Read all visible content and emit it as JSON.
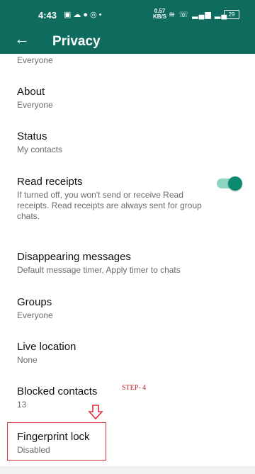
{
  "status_bar": {
    "time": "4:43",
    "speed": "0.57",
    "speed_unit": "KB/S",
    "battery": "29"
  },
  "header": {
    "title": "Privacy"
  },
  "partial_top": {
    "subtitle": "Everyone"
  },
  "settings": [
    {
      "title": "About",
      "subtitle": "Everyone"
    },
    {
      "title": "Status",
      "subtitle": "My contacts"
    },
    {
      "title": "Read receipts",
      "subtitle": "If turned off, you won't send or receive Read receipts. Read receipts are always sent for group chats.",
      "toggle_on": true
    },
    {
      "title": "Disappearing messages",
      "subtitle": "Default message timer, Apply timer to chats"
    },
    {
      "title": "Groups",
      "subtitle": "Everyone"
    },
    {
      "title": "Live location",
      "subtitle": "None"
    },
    {
      "title": "Blocked contacts",
      "subtitle": "13"
    },
    {
      "title": "Fingerprint lock",
      "subtitle": "Disabled"
    }
  ],
  "annotation": {
    "step_label": "STEP- 4",
    "color": "#c0202a"
  },
  "colors": {
    "header_bg": "#0e6b5d",
    "toggle_knob": "#0c8a6f",
    "toggle_track": "#8fd4c3"
  },
  "icons": [
    "back-arrow-icon",
    "gallery-icon",
    "cloud-icon",
    "messenger-icon",
    "instagram-icon",
    "wifi-icon",
    "volte-icon",
    "signal-icon",
    "battery-icon",
    "down-arrow-icon"
  ]
}
